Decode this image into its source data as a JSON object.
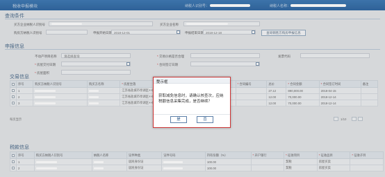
{
  "topbar": {
    "title": "税收申报模块",
    "taxpayer_label": "纳税人识别号：",
    "taxpayer_name_label": "纳税人名称："
  },
  "query": {
    "section_title": "查询条件",
    "seller_id_label": "买方企业纳税人识别号",
    "buyer_label": "买方企业名称",
    "seller_id2_label": "购房方纳税人识别号",
    "start_date_label": "申报开始日期",
    "start_date_value": "2018-12-01",
    "end_date_label": "申报结束日期",
    "end_date_value": "2018-12-18",
    "query_button": "查询销售方购房申报信息"
  },
  "declare": {
    "section_title": "申报信息",
    "property_type_label": "不动产项目名称",
    "property_type_value": "请选择查询",
    "transaction_label": "交易价格是否合理",
    "invoice_label": "发票代码",
    "start_label": "房屋交付日期",
    "end_label": "合同签订日期",
    "area_label": "房屋面积"
  },
  "trade": {
    "section_title": "交易信息",
    "columns": [
      "序号",
      "购买方纳税人识别号",
      "购买方名称",
      "房屋坐落",
      "房屋面积",
      "合同编号",
      "总价",
      "合同金额",
      "合同签订时间",
      "备注"
    ],
    "rows": [
      {
        "address": "江苏省盐城市亭湖区××街道1单元",
        "area": "27.12",
        "amount": "890,000.00",
        "date": "2018-04-15"
      },
      {
        "address": "江苏省盐城市亭湖区××街道1单元",
        "area": "12.00",
        "amount": "70,000.00",
        "date": "2018-12-14"
      },
      {
        "address": "江苏省盐城市亭湖区××街道1单元",
        "area": "12.00",
        "amount": "70,000.00",
        "date": "2018-12-14"
      }
    ],
    "pager_info": "每页显示",
    "pager_page": "1/10"
  },
  "tax": {
    "section_title": "税款信息",
    "columns": [
      "序号",
      "购买方纳税人识别号",
      "纳税人名称",
      "证件种类",
      "证件号码",
      "持有份额（%）",
      "开户银行",
      "征收项目",
      "征收品目",
      "征收子目"
    ],
    "rows": [
      {
        "idtype": "居民身份证",
        "share": "100.00",
        "item": "契税",
        "sub": "房屋买卖"
      },
      {
        "idtype": "居民身份证",
        "share": "100.00",
        "item": "契税",
        "sub": "房屋买卖"
      }
    ]
  },
  "dialog": {
    "title": "提示框",
    "close": "×",
    "message": "获取减免信息时，请确认核查次，应纳税额信息采集完成，是否继续？",
    "yes": "是",
    "no": "否"
  }
}
